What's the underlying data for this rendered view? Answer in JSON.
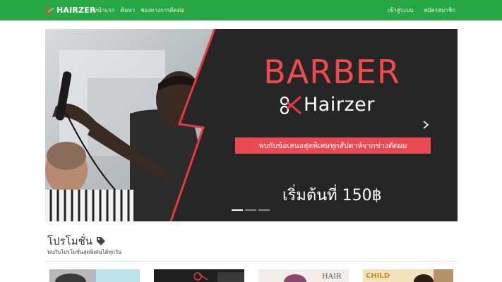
{
  "navbar": {
    "brand": "HAIRZER",
    "left_links": [
      "หน้าแรก",
      "ค้นหา",
      "ช่องทางการติดต่อ"
    ],
    "right_links": [
      "เข้าสู่ระบบ",
      "สมัครสมาชิก"
    ],
    "background": "#28a745",
    "brand_icon": "scissors-comb-icon"
  },
  "carousel": {
    "headline": "BARBER",
    "brand": "Hairzer",
    "offer": "พบกับข้อเสนอสุดพิเศษทุกสัปดาห์จากช่างตัดผม",
    "price": "เริ่มต้นที่ 150฿",
    "slides_count": 3,
    "active_slide": 1,
    "accent": "#f04a4e",
    "next_icon": "chevron-right-icon"
  },
  "promotions": {
    "title": "โปรโมชั่น",
    "subtitle": "พบกับโปรโมชั่นสุดพิเศษได้ทุกวัน",
    "title_icon": "tag-icon",
    "cards": [
      {
        "label": ""
      },
      {
        "label": ""
      },
      {
        "label": "HAIR"
      },
      {
        "label": "CHILD"
      }
    ]
  }
}
